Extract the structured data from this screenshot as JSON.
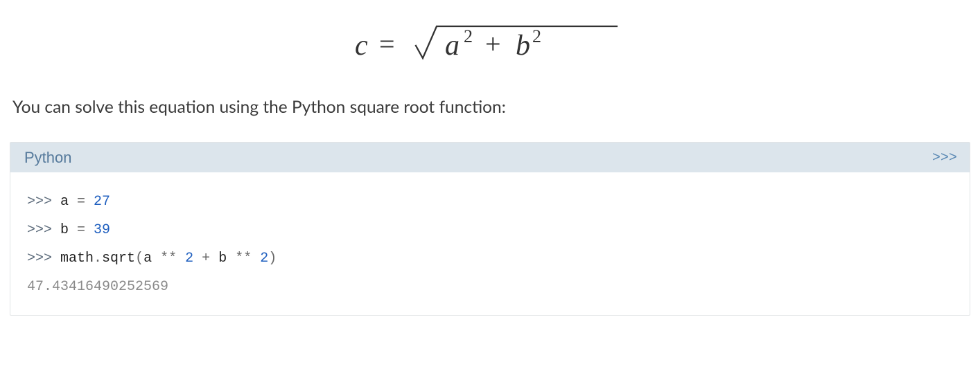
{
  "equation": {
    "alt": "c equals square root of a squared plus b squared"
  },
  "description": "You can solve this equation using the Python square root function:",
  "code": {
    "language": "Python",
    "toggle": ">>>",
    "lines": {
      "l1": {
        "prompt": ">>> ",
        "var": "a",
        "eq": " = ",
        "val": "27"
      },
      "l2": {
        "prompt": ">>> ",
        "var": "b",
        "eq": " = ",
        "val": "39"
      },
      "l3": {
        "prompt": ">>> ",
        "obj": "math",
        "dot": ".",
        "fn": "sqrt",
        "lp": "(",
        "a": "a",
        "s1": " ",
        "star1": "**",
        "s2": " ",
        "two1": "2",
        "s3": " ",
        "plus": "+",
        "s4": " ",
        "b": "b",
        "s5": " ",
        "star2": "**",
        "s6": " ",
        "two2": "2",
        "rp": ")"
      },
      "output": "47.43416490252569"
    }
  }
}
